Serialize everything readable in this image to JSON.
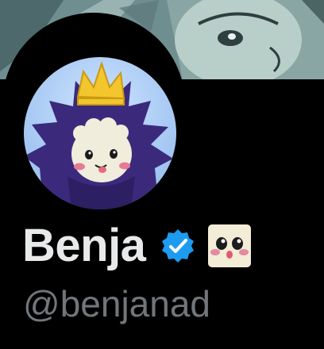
{
  "profile": {
    "display_name": "Benja",
    "handle": "@benjanad",
    "verified": true,
    "name_emoji": "kawaii-face-emoji",
    "banner": "anime-illustration-banner",
    "avatar": "crowned-spiky-creature-avatar"
  },
  "colors": {
    "background": "#000000",
    "name_text": "#e7e9ea",
    "handle_text": "#71767b",
    "verified_badge": "#1d9bf0"
  }
}
